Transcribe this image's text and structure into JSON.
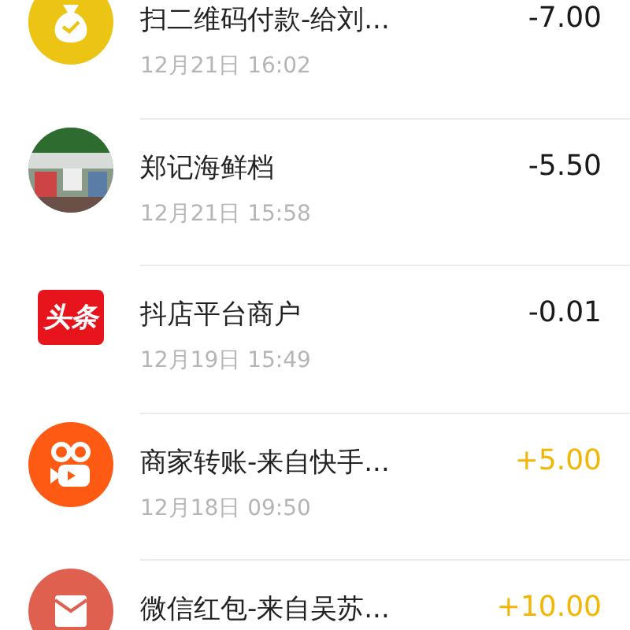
{
  "transactions": [
    {
      "kind": "money-bag",
      "title": "扫二维码付款-给刘...",
      "time": "12月21日 16:02",
      "amount": "-7.00",
      "income": false
    },
    {
      "kind": "picture",
      "title": "郑记海鲜档",
      "time": "12月21日 15:58",
      "amount": "-5.50",
      "income": false
    },
    {
      "kind": "news-logo",
      "logo_text": "头条",
      "title": "抖店平台商户",
      "time": "12月19日 15:49",
      "amount": "-0.01",
      "income": false
    },
    {
      "kind": "video-camera",
      "title": "商家转账-来自快手...",
      "time": "12月18日 09:50",
      "amount": "+5.00",
      "income": true
    },
    {
      "kind": "envelope",
      "title": "微信红包-来自吴苏...",
      "amount": "+10.00",
      "income": true
    }
  ]
}
